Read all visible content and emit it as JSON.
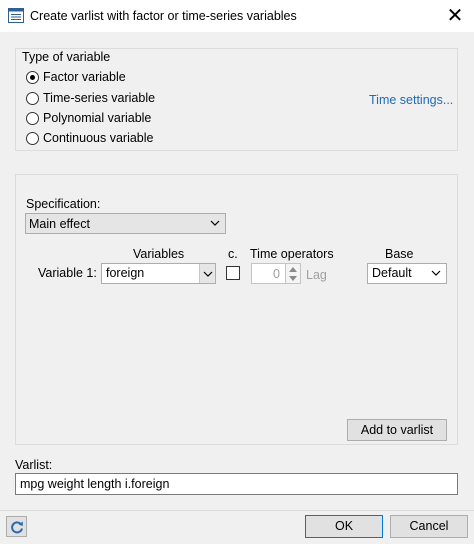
{
  "window": {
    "title": "Create varlist with factor or time-series variables",
    "close_glyph": "✕"
  },
  "type_of_variable": {
    "legend": "Type of variable",
    "options": [
      {
        "label": "Factor variable",
        "checked": true
      },
      {
        "label": "Time-series variable",
        "checked": false
      },
      {
        "label": "Polynomial variable",
        "checked": false
      },
      {
        "label": "Continuous variable",
        "checked": false
      }
    ],
    "time_settings_link": "Time settings..."
  },
  "specification": {
    "label": "Specification:",
    "selected": "Main effect",
    "columns": {
      "variables": "Variables",
      "c": "c.",
      "time_operators": "Time operators",
      "base": "Base"
    },
    "row": {
      "label": "Variable 1:",
      "variable_value": "foreign",
      "continuous_checked": false,
      "lag_value": "0",
      "lag_label": "Lag",
      "base_value": "Default"
    },
    "add_button": "Add to varlist"
  },
  "varlist": {
    "label": "Varlist:",
    "value": "mpg weight length i.foreign"
  },
  "buttons": {
    "ok": "OK",
    "cancel": "Cancel"
  },
  "icons": {
    "app": "dialog-app-icon",
    "reset": "reset-refresh-icon"
  },
  "colors": {
    "link": "#1e6bb8",
    "ok_border": "#0078d7",
    "reset_icon": "#2b6cb0"
  }
}
